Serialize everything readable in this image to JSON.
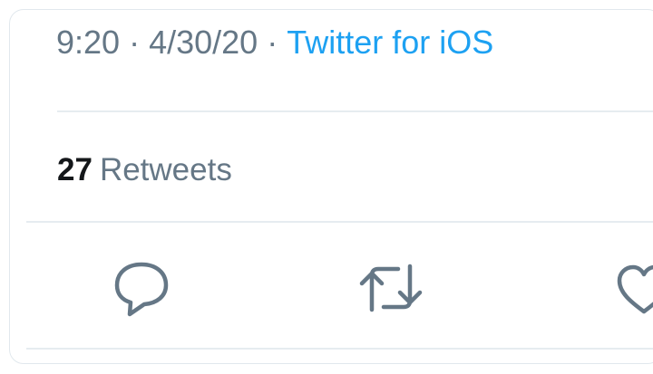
{
  "tweet": {
    "time": "9:20",
    "date": "4/30/20",
    "separator": "·",
    "source": "Twitter for iOS"
  },
  "stats": {
    "retweet_count": "27",
    "retweet_label": "Retweets"
  },
  "actions": [
    {
      "name": "reply",
      "icon": "reply-icon"
    },
    {
      "name": "retweet",
      "icon": "retweet-icon"
    },
    {
      "name": "like",
      "icon": "heart-icon"
    }
  ],
  "colors": {
    "muted": "#657786",
    "text": "#14171a",
    "accent": "#1da1f2",
    "border": "#e6ecf0"
  }
}
